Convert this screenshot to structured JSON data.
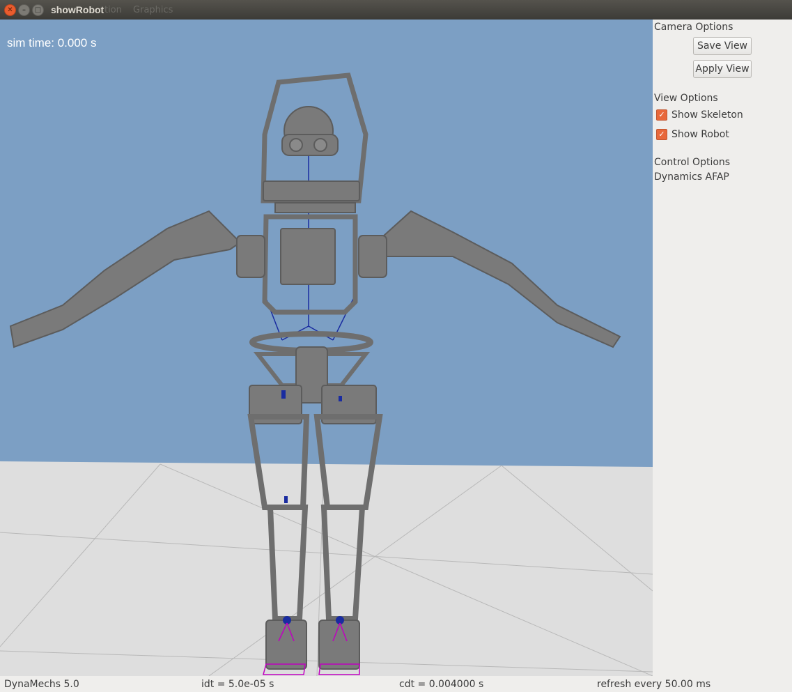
{
  "window": {
    "title": "showRobot",
    "ghost_menu": [
      "tion",
      "Graphics"
    ]
  },
  "viewport": {
    "sim_time": "sim time: 0.000 s",
    "sky_color": "#7c9fc4",
    "floor_color": "#dcdcdc",
    "robot_color": "#7a7a7a",
    "skeleton_color": "#1a2ca0",
    "contact_color": "#c000c0"
  },
  "panel": {
    "camera_options": "Camera Options",
    "save_view": "Save View",
    "apply_view": "Apply View",
    "view_options": "View Options",
    "show_skeleton": "Show Skeleton",
    "show_robot": "Show Robot",
    "control_options": "Control Options",
    "dynamics_mode": "Dynamics AFAP",
    "show_skeleton_checked": true,
    "show_robot_checked": true,
    "accent": "#e8683b"
  },
  "status": {
    "version": "DynaMechs 5.0",
    "idt": "idt = 5.0e-05 s",
    "cdt": "cdt = 0.004000 s",
    "refresh": "refresh every 50.00 ms"
  }
}
